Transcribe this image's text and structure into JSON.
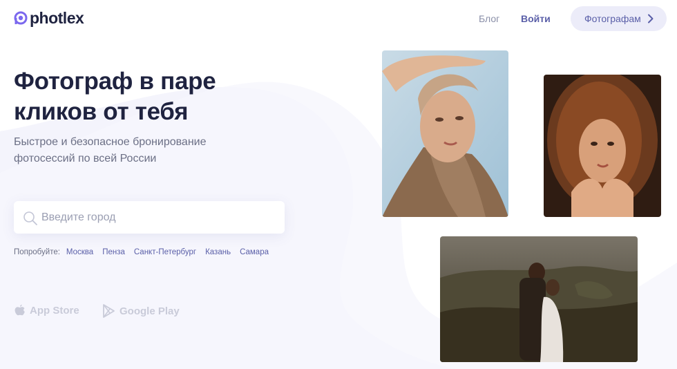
{
  "header": {
    "logo_text": "photlex",
    "nav": {
      "blog": "Блог",
      "login": "Войти",
      "photographers": "Фотографам"
    }
  },
  "hero": {
    "title_line1": "Фотограф в паре",
    "title_line2": "кликов от тебя",
    "subtitle_line1": "Быстрое и безопасное бронирование",
    "subtitle_line2": "фотосессий по всей России"
  },
  "search": {
    "placeholder": "Введите город",
    "value": ""
  },
  "suggestions": {
    "label": "Попробуйте:",
    "cities": [
      "Москва",
      "Пенза",
      "Санкт-Петербург",
      "Казань",
      "Самара"
    ]
  },
  "stores": {
    "app_store": "App Store",
    "google_play": "Google Play"
  },
  "colors": {
    "brand": "#7b68ee",
    "accent": "#5a5fa8",
    "title": "#1f2340",
    "muted": "#6b6f85",
    "pill_bg": "#ececf9"
  },
  "icons": {
    "search": "search-icon",
    "chevron": "chevron-right-icon",
    "apple": "apple-icon",
    "google_play": "google-play-icon"
  }
}
